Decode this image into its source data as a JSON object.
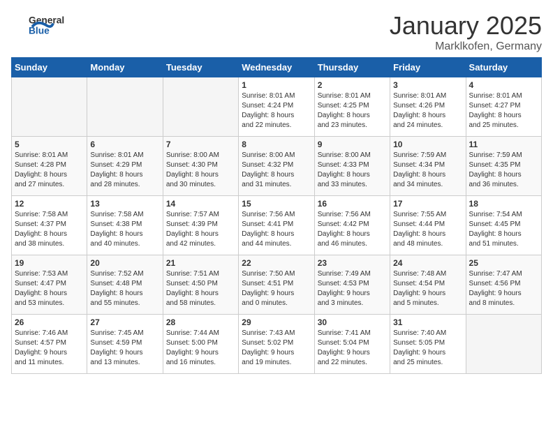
{
  "header": {
    "logo_general": "General",
    "logo_blue": "Blue",
    "month": "January 2025",
    "location": "Marklkofen, Germany"
  },
  "weekdays": [
    "Sunday",
    "Monday",
    "Tuesday",
    "Wednesday",
    "Thursday",
    "Friday",
    "Saturday"
  ],
  "weeks": [
    [
      {
        "day": "",
        "content": ""
      },
      {
        "day": "",
        "content": ""
      },
      {
        "day": "",
        "content": ""
      },
      {
        "day": "1",
        "content": "Sunrise: 8:01 AM\nSunset: 4:24 PM\nDaylight: 8 hours\nand 22 minutes."
      },
      {
        "day": "2",
        "content": "Sunrise: 8:01 AM\nSunset: 4:25 PM\nDaylight: 8 hours\nand 23 minutes."
      },
      {
        "day": "3",
        "content": "Sunrise: 8:01 AM\nSunset: 4:26 PM\nDaylight: 8 hours\nand 24 minutes."
      },
      {
        "day": "4",
        "content": "Sunrise: 8:01 AM\nSunset: 4:27 PM\nDaylight: 8 hours\nand 25 minutes."
      }
    ],
    [
      {
        "day": "5",
        "content": "Sunrise: 8:01 AM\nSunset: 4:28 PM\nDaylight: 8 hours\nand 27 minutes."
      },
      {
        "day": "6",
        "content": "Sunrise: 8:01 AM\nSunset: 4:29 PM\nDaylight: 8 hours\nand 28 minutes."
      },
      {
        "day": "7",
        "content": "Sunrise: 8:00 AM\nSunset: 4:30 PM\nDaylight: 8 hours\nand 30 minutes."
      },
      {
        "day": "8",
        "content": "Sunrise: 8:00 AM\nSunset: 4:32 PM\nDaylight: 8 hours\nand 31 minutes."
      },
      {
        "day": "9",
        "content": "Sunrise: 8:00 AM\nSunset: 4:33 PM\nDaylight: 8 hours\nand 33 minutes."
      },
      {
        "day": "10",
        "content": "Sunrise: 7:59 AM\nSunset: 4:34 PM\nDaylight: 8 hours\nand 34 minutes."
      },
      {
        "day": "11",
        "content": "Sunrise: 7:59 AM\nSunset: 4:35 PM\nDaylight: 8 hours\nand 36 minutes."
      }
    ],
    [
      {
        "day": "12",
        "content": "Sunrise: 7:58 AM\nSunset: 4:37 PM\nDaylight: 8 hours\nand 38 minutes."
      },
      {
        "day": "13",
        "content": "Sunrise: 7:58 AM\nSunset: 4:38 PM\nDaylight: 8 hours\nand 40 minutes."
      },
      {
        "day": "14",
        "content": "Sunrise: 7:57 AM\nSunset: 4:39 PM\nDaylight: 8 hours\nand 42 minutes."
      },
      {
        "day": "15",
        "content": "Sunrise: 7:56 AM\nSunset: 4:41 PM\nDaylight: 8 hours\nand 44 minutes."
      },
      {
        "day": "16",
        "content": "Sunrise: 7:56 AM\nSunset: 4:42 PM\nDaylight: 8 hours\nand 46 minutes."
      },
      {
        "day": "17",
        "content": "Sunrise: 7:55 AM\nSunset: 4:44 PM\nDaylight: 8 hours\nand 48 minutes."
      },
      {
        "day": "18",
        "content": "Sunrise: 7:54 AM\nSunset: 4:45 PM\nDaylight: 8 hours\nand 51 minutes."
      }
    ],
    [
      {
        "day": "19",
        "content": "Sunrise: 7:53 AM\nSunset: 4:47 PM\nDaylight: 8 hours\nand 53 minutes."
      },
      {
        "day": "20",
        "content": "Sunrise: 7:52 AM\nSunset: 4:48 PM\nDaylight: 8 hours\nand 55 minutes."
      },
      {
        "day": "21",
        "content": "Sunrise: 7:51 AM\nSunset: 4:50 PM\nDaylight: 8 hours\nand 58 minutes."
      },
      {
        "day": "22",
        "content": "Sunrise: 7:50 AM\nSunset: 4:51 PM\nDaylight: 9 hours\nand 0 minutes."
      },
      {
        "day": "23",
        "content": "Sunrise: 7:49 AM\nSunset: 4:53 PM\nDaylight: 9 hours\nand 3 minutes."
      },
      {
        "day": "24",
        "content": "Sunrise: 7:48 AM\nSunset: 4:54 PM\nDaylight: 9 hours\nand 5 minutes."
      },
      {
        "day": "25",
        "content": "Sunrise: 7:47 AM\nSunset: 4:56 PM\nDaylight: 9 hours\nand 8 minutes."
      }
    ],
    [
      {
        "day": "26",
        "content": "Sunrise: 7:46 AM\nSunset: 4:57 PM\nDaylight: 9 hours\nand 11 minutes."
      },
      {
        "day": "27",
        "content": "Sunrise: 7:45 AM\nSunset: 4:59 PM\nDaylight: 9 hours\nand 13 minutes."
      },
      {
        "day": "28",
        "content": "Sunrise: 7:44 AM\nSunset: 5:00 PM\nDaylight: 9 hours\nand 16 minutes."
      },
      {
        "day": "29",
        "content": "Sunrise: 7:43 AM\nSunset: 5:02 PM\nDaylight: 9 hours\nand 19 minutes."
      },
      {
        "day": "30",
        "content": "Sunrise: 7:41 AM\nSunset: 5:04 PM\nDaylight: 9 hours\nand 22 minutes."
      },
      {
        "day": "31",
        "content": "Sunrise: 7:40 AM\nSunset: 5:05 PM\nDaylight: 9 hours\nand 25 minutes."
      },
      {
        "day": "",
        "content": ""
      }
    ]
  ]
}
